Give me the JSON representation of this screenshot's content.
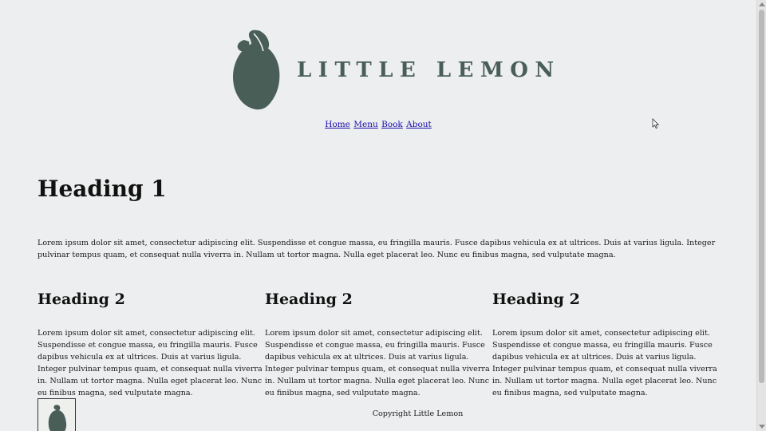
{
  "header": {
    "logo_text": "LITTLE LEMON",
    "nav": {
      "home": "Home",
      "menu": "Menu",
      "book": "Book",
      "about": "About"
    }
  },
  "main": {
    "heading1": "Heading 1",
    "intro": "Lorem ipsum dolor sit amet, consectetur adipiscing elit. Suspendisse et congue massa, eu fringilla mauris. Fusce dapibus vehicula ex at ultrices. Duis at varius ligula. Integer pulvinar tempus quam, et consequat nulla viverra in. Nullam ut tortor magna. Nulla eget placerat leo. Nunc eu finibus magna, sed vulputate magna.",
    "columns": [
      {
        "heading": "Heading 2",
        "text": "Lorem ipsum dolor sit amet, consectetur adipiscing elit. Suspendisse et congue massa, eu fringilla mauris. Fusce dapibus vehicula ex at ultrices. Duis at varius ligula. Integer pulvinar tempus quam, et consequat nulla viverra in. Nullam ut tortor magna. Nulla eget placerat leo. Nunc eu finibus magna, sed vulputate magna."
      },
      {
        "heading": "Heading 2",
        "text": "Lorem ipsum dolor sit amet, consectetur adipiscing elit. Suspendisse et congue massa, eu fringilla mauris. Fusce dapibus vehicula ex at ultrices. Duis at varius ligula. Integer pulvinar tempus quam, et consequat nulla viverra in. Nullam ut tortor magna. Nulla eget placerat leo. Nunc eu finibus magna, sed vulputate magna."
      },
      {
        "heading": "Heading 2",
        "text": "Lorem ipsum dolor sit amet, consectetur adipiscing elit. Suspendisse et congue massa, eu fringilla mauris. Fusce dapibus vehicula ex at ultrices. Duis at varius ligula. Integer pulvinar tempus quam, et consequat nulla viverra in. Nullam ut tortor magna. Nulla eget placerat leo. Nunc eu finibus magna, sed vulputate magna."
      }
    ]
  },
  "footer": {
    "copyright": "Copyright Little Lemon",
    "logo_icon": "lemon-icon"
  },
  "colors": {
    "background": "#edeeef",
    "brand_green": "#495e57",
    "link": "#1a0dab"
  }
}
